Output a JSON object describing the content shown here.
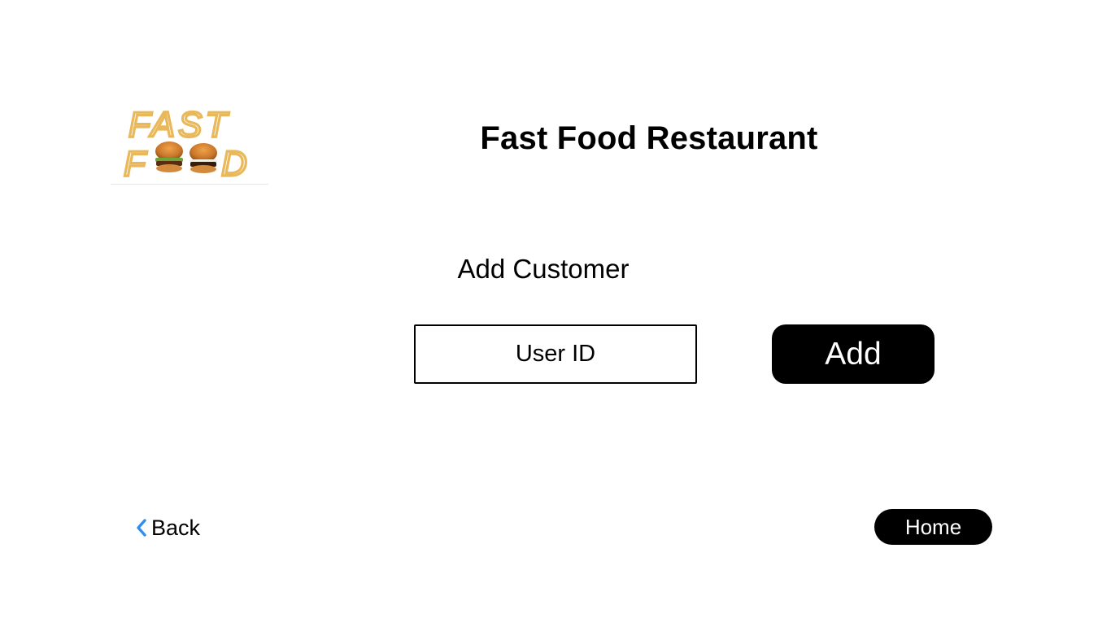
{
  "header": {
    "logo_icon": "fast-food-logo-icon",
    "logo_lines": [
      "FAST",
      "F",
      "D"
    ],
    "title": "Fast Food Restaurant"
  },
  "form": {
    "section_title": "Add Customer",
    "user_id_placeholder": "User ID",
    "user_id_value": "",
    "add_label": "Add"
  },
  "footer": {
    "back_icon": "chevron-left-icon",
    "back_label": "Back",
    "home_label": "Home"
  },
  "colors": {
    "background": "#ffffff",
    "text": "#000000",
    "button_bg": "#000000",
    "button_text": "#ffffff",
    "accent": "#2f8ff0",
    "fries": "#e9b85a"
  }
}
